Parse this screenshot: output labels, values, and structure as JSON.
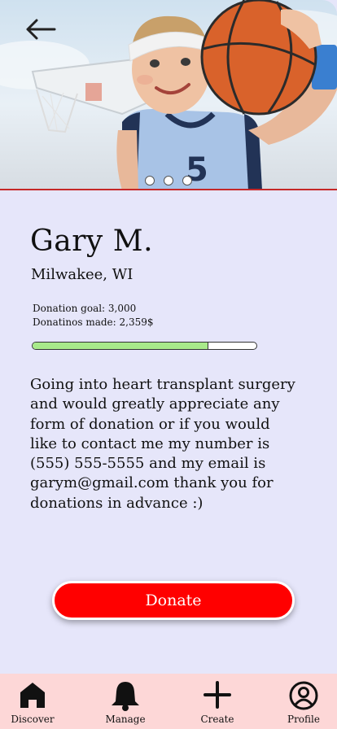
{
  "hero": {
    "slide_count": 3,
    "jersey_number": "5"
  },
  "profile": {
    "name": "Gary M.",
    "location": "Milwakee, WI",
    "donation_goal": "Donation goal: 3,000",
    "donations_made": "Donatinos made: 2,359$",
    "progress_fraction": 0.786,
    "description": "Going into heart transplant surgery and would greatly appreciate any form of donation or if you would like to contact me my number is (555) 555-5555 and my email is garym@gmail.com thank you for donations in advance :)"
  },
  "actions": {
    "donate_label": "Donate"
  },
  "nav": {
    "items": [
      {
        "label": "Discover",
        "icon": "home-icon"
      },
      {
        "label": "Manage",
        "icon": "bell-icon"
      },
      {
        "label": "Create",
        "icon": "plus-icon"
      },
      {
        "label": "Profile",
        "icon": "user-circle-icon"
      }
    ]
  },
  "colors": {
    "background": "#e6e6fa",
    "accent_red": "#ff0000",
    "progress_green": "#a8ea8a",
    "nav_background": "#fdd7d7"
  }
}
